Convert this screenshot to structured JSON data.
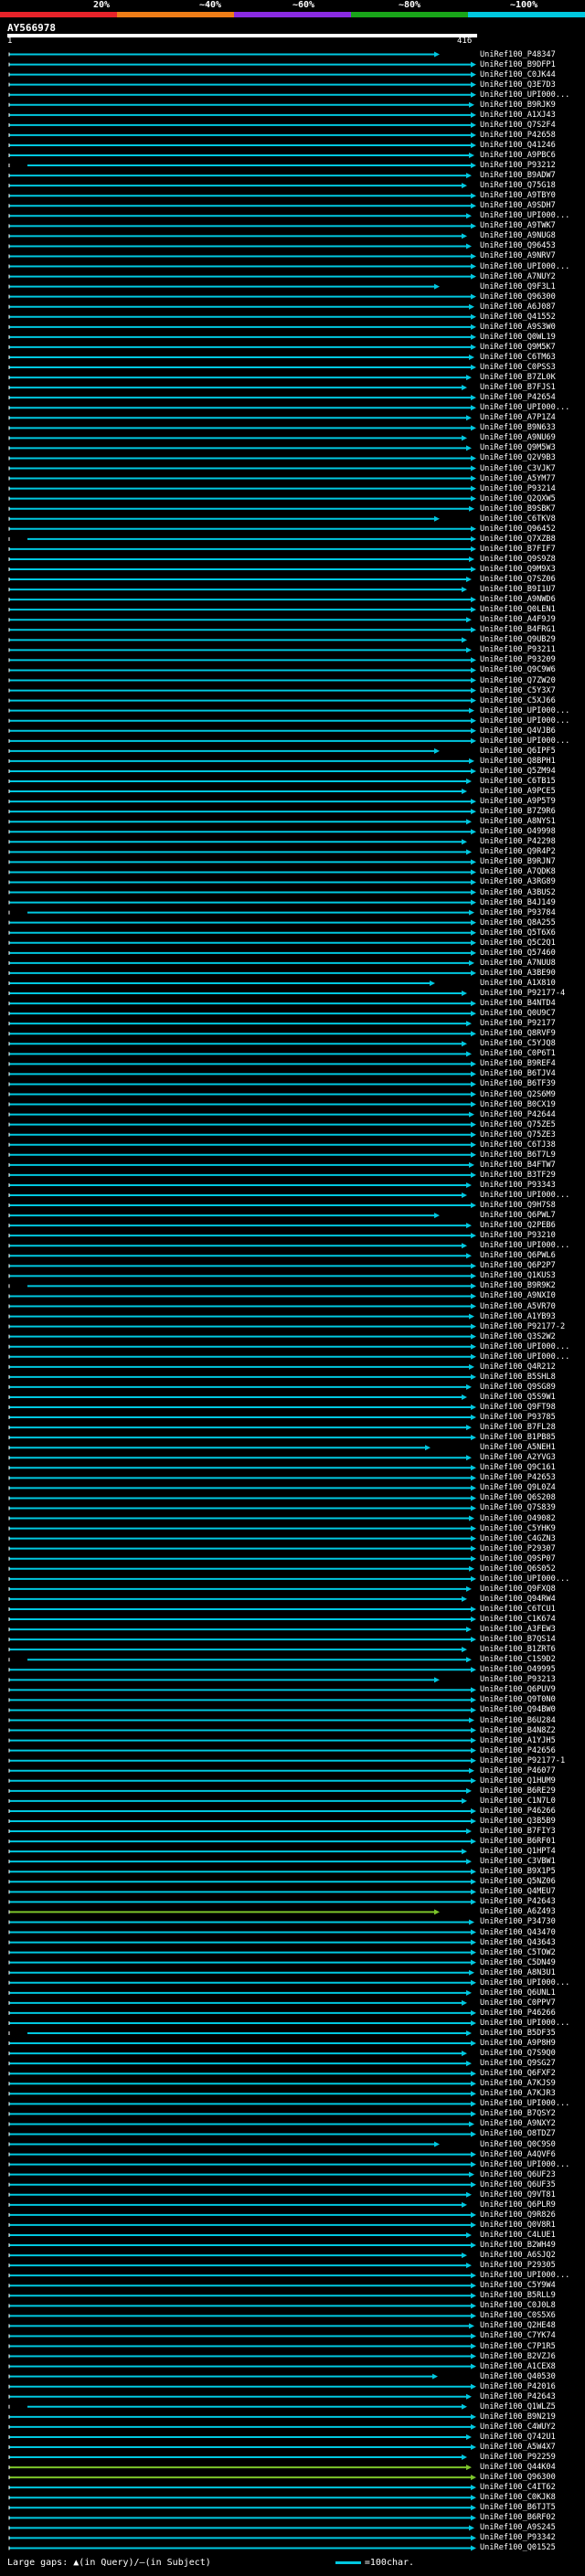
{
  "legend": {
    "labels": [
      "20%",
      "~40%",
      "~60%",
      "~80%",
      "~100%"
    ],
    "colors": [
      "#e8232a",
      "#ef7d17",
      "#8a2be2",
      "#19a519",
      "#00c8e0"
    ]
  },
  "query": {
    "title": "AY566978",
    "ruler_start": "1",
    "ruler_end": "416"
  },
  "hits": {
    "default_color": "#00c8e0",
    "highlight_color": "#7cc42a",
    "highlight_rows": [
      184,
      239,
      240,
      267,
      279
    ],
    "labels": [
      "UniRef100_P48347",
      "UniRef100_B9DFP1",
      "UniRef100_C0JK44",
      "UniRef100_Q3E7D3",
      "UniRef100_UPI000...",
      "UniRef100_B9RJK9",
      "UniRef100_A1XJ43",
      "UniRef100_Q7S2F4",
      "UniRef100_P42658",
      "UniRef100_Q41246",
      "UniRef100_A9PBC6",
      "UniRef100_P93212",
      "UniRef100_B9ADW7",
      "UniRef100_Q75G18",
      "UniRef100_A9TBY0",
      "UniRef100_A9SDH7",
      "UniRef100_UPI000...",
      "UniRef100_A9TWK7",
      "UniRef100_A9NUG8",
      "UniRef100_Q96453",
      "UniRef100_A9NRV7",
      "UniRef100_UPI000...",
      "UniRef100_A7NUY2",
      "UniRef100_Q9F3L1",
      "UniRef100_Q96300",
      "UniRef100_A6J087",
      "UniRef100_Q41552",
      "UniRef100_A9S3W0",
      "UniRef100_Q0WL19",
      "UniRef100_Q9M5K7",
      "UniRef100_C6TM63",
      "UniRef100_C0PSS3",
      "UniRef100_B7ZL0K",
      "UniRef100_B7FJS1",
      "UniRef100_P42654",
      "UniRef100_UPI000...",
      "UniRef100_A7P1Z4",
      "UniRef100_B9N633",
      "UniRef100_A9NU69",
      "UniRef100_Q9M5W3",
      "UniRef100_Q2V9B3",
      "UniRef100_C3VJK7",
      "UniRef100_A5YM77",
      "UniRef100_P93214",
      "UniRef100_Q2QXW5",
      "UniRef100_B9SBK7",
      "UniRef100_C6TKV8",
      "UniRef100_Q96452",
      "UniRef100_Q7XZB8",
      "UniRef100_B7FIF7",
      "UniRef100_Q9S9Z8",
      "UniRef100_Q9M9X3",
      "UniRef100_Q7SZ06",
      "UniRef100_B9I1U7",
      "UniRef100_A9NWD6",
      "UniRef100_Q0LEN1",
      "UniRef100_A4F9J9",
      "UniRef100_B4FRG1",
      "UniRef100_Q9UB29",
      "UniRef100_P93211",
      "UniRef100_P93209",
      "UniRef100_Q9C9W6",
      "UniRef100_Q7ZW20",
      "UniRef100_C5Y3X7",
      "UniRef100_C5XJ66",
      "UniRef100_UPI000...",
      "UniRef100_UPI000...",
      "UniRef100_Q4VJB6",
      "UniRef100_UPI000...",
      "UniRef100_Q6IPF5",
      "UniRef100_Q8BPH1",
      "UniRef100_Q5ZM94",
      "UniRef100_C6TB15",
      "UniRef100_A9PCE5",
      "UniRef100_A9P5T9",
      "UniRef100_B7Z9R6",
      "UniRef100_A8NYS1",
      "UniRef100_O49998",
      "UniRef100_P42298",
      "UniRef100_Q9R4P2",
      "UniRef100_B9RJN7",
      "UniRef100_A7QDK8",
      "UniRef100_A3RG89",
      "UniRef100_A3BUS2",
      "UniRef100_B4J149",
      "UniRef100_P93784",
      "UniRef100_Q8A255",
      "UniRef100_Q5T6X6",
      "UniRef100_Q5C2Q1",
      "UniRef100_Q57460",
      "UniRef100_A7NUU8",
      "UniRef100_A3BE90",
      "UniRef100_A1X810",
      "UniRef100_P92177-4",
      "UniRef100_B4NTD4",
      "UniRef100_Q0U9C7",
      "UniRef100_P92177",
      "UniRef100_Q8RVF9",
      "UniRef100_C5YJQ8",
      "UniRef100_C0P6T1",
      "UniRef100_B9REF4",
      "UniRef100_B6TJV4",
      "UniRef100_B6TF39",
      "UniRef100_Q2S6M9",
      "UniRef100_B0CX19",
      "UniRef100_P42644",
      "UniRef100_Q75ZE5",
      "UniRef100_Q75ZE3",
      "UniRef100_C6TJ38",
      "UniRef100_B6T7L9",
      "UniRef100_B4FTW7",
      "UniRef100_B3TF29",
      "UniRef100_P93343",
      "UniRef100_UPI000...",
      "UniRef100_Q9H7S8",
      "UniRef100_Q6PWL7",
      "UniRef100_Q2PEB6",
      "UniRef100_P93210",
      "UniRef100_UPI000...",
      "UniRef100_Q6PWL6",
      "UniRef100_Q6P2P7",
      "UniRef100_Q1KUS3",
      "UniRef100_B9R9K2",
      "UniRef100_A9NXI0",
      "UniRef100_A5VR70",
      "UniRef100_A1YB93",
      "UniRef100_P92177-2",
      "UniRef100_Q3S2W2",
      "UniRef100_UPI000...",
      "UniRef100_UPI000...",
      "UniRef100_Q4R212",
      "UniRef100_B5SHL8",
      "UniRef100_Q9SG89",
      "UniRef100_Q5S9W1",
      "UniRef100_Q9FT98",
      "UniRef100_P93785",
      "UniRef100_B7FL28",
      "UniRef100_B1PB85",
      "UniRef100_A5NEH1",
      "UniRef100_A2YVG3",
      "UniRef100_Q9C161",
      "UniRef100_P42653",
      "UniRef100_Q9L0Z4",
      "UniRef100_Q6S208",
      "UniRef100_Q7S839",
      "UniRef100_O49082",
      "UniRef100_C5YHK9",
      "UniRef100_C4GZN3",
      "UniRef100_P29307",
      "UniRef100_Q9SP07",
      "UniRef100_Q6S052",
      "UniRef100_UPI000...",
      "UniRef100_Q9FXQ8",
      "UniRef100_Q94RW4",
      "UniRef100_C6TCU1",
      "UniRef100_C1K674",
      "UniRef100_A3FEW3",
      "UniRef100_B7QS14",
      "UniRef100_B1ZRT6",
      "UniRef100_C1S9D2",
      "UniRef100_O49995",
      "UniRef100_P93213",
      "UniRef100_Q6PUV9",
      "UniRef100_Q9T0N0",
      "UniRef100_Q94BW0",
      "UniRef100_B6U284",
      "UniRef100_B4N8Z2",
      "UniRef100_A1YJH5",
      "UniRef100_P42656",
      "UniRef100_P92177-1",
      "UniRef100_P46077",
      "UniRef100_Q1HUM9",
      "UniRef100_B6RE29",
      "UniRef100_C1N7L0",
      "UniRef100_P46266",
      "UniRef100_Q3B5B9",
      "UniRef100_B7FIY3",
      "UniRef100_B6RF01",
      "UniRef100_Q1HPT4",
      "UniRef100_C3VBW1",
      "UniRef100_B9X1P5",
      "UniRef100_Q5NZ06",
      "UniRef100_Q4MEU7",
      "UniRef100_P42643",
      "UniRef100_A6Z493",
      "UniRef100_P34730",
      "UniRef100_Q43470",
      "UniRef100_Q43643",
      "UniRef100_C5TOW2",
      "UniRef100_C5DN49",
      "UniRef100_A8N3U1",
      "UniRef100_UPI000...",
      "UniRef100_Q6UNL1",
      "UniRef100_C0PPV7",
      "UniRef100_P46266",
      "UniRef100_UPI000...",
      "UniRef100_B5DF35",
      "UniRef100_A9P8H9",
      "UniRef100_Q7S9Q0",
      "UniRef100_Q9SG27",
      "UniRef100_Q6FXF2",
      "UniRef100_A7KJS9",
      "UniRef100_A7KJR3",
      "UniRef100_UPI000...",
      "UniRef100_B7QSY2",
      "UniRef100_A9NXY2",
      "UniRef100_O8TDZ7",
      "UniRef100_Q0C9S0",
      "UniRef100_A4QVF6",
      "UniRef100_UPI000...",
      "UniRef100_Q6UF23",
      "UniRef100_Q6UF35",
      "UniRef100_Q9VT81",
      "UniRef100_Q6PLR9",
      "UniRef100_Q9R826",
      "UniRef100_Q0V8R1",
      "UniRef100_C4LUE1",
      "UniRef100_B2WH49",
      "UniRef100_A6SJQ2",
      "UniRef100_P29305",
      "UniRef100_UPI000...",
      "UniRef100_C5Y9W4",
      "UniRef100_B5RLL9",
      "UniRef100_C0J0L8",
      "UniRef100_C0S5X6",
      "UniRef100_Q2HE48",
      "UniRef100_C7YK74",
      "UniRef100_C7P1R5",
      "UniRef100_B2VZJ6",
      "UniRef100_A1CEX8",
      "UniRef100_Q40530",
      "UniRef100_P42016",
      "UniRef100_P42643",
      "UniRef100_Q1WLZ5",
      "UniRef100_B9N219",
      "UniRef100_C4WUY2",
      "UniRef100_Q742U1",
      "UniRef100_A5W4X7",
      "UniRef100_P92259",
      "UniRef100_Q44K04",
      "UniRef100_Q96300",
      "UniRef100_C4IT62",
      "UniRef100_C0KJK8",
      "UniRef100_B6TJT5",
      "UniRef100_B6RF02",
      "UniRef100_A9S245",
      "UniRef100_P93342",
      "UniRef100_Q01525"
    ]
  },
  "footer": {
    "gaps_label": "Large gaps:",
    "gap_query": "(in Query)",
    "gap_subject": "(in Subject)",
    "scale_label": "=100char."
  }
}
